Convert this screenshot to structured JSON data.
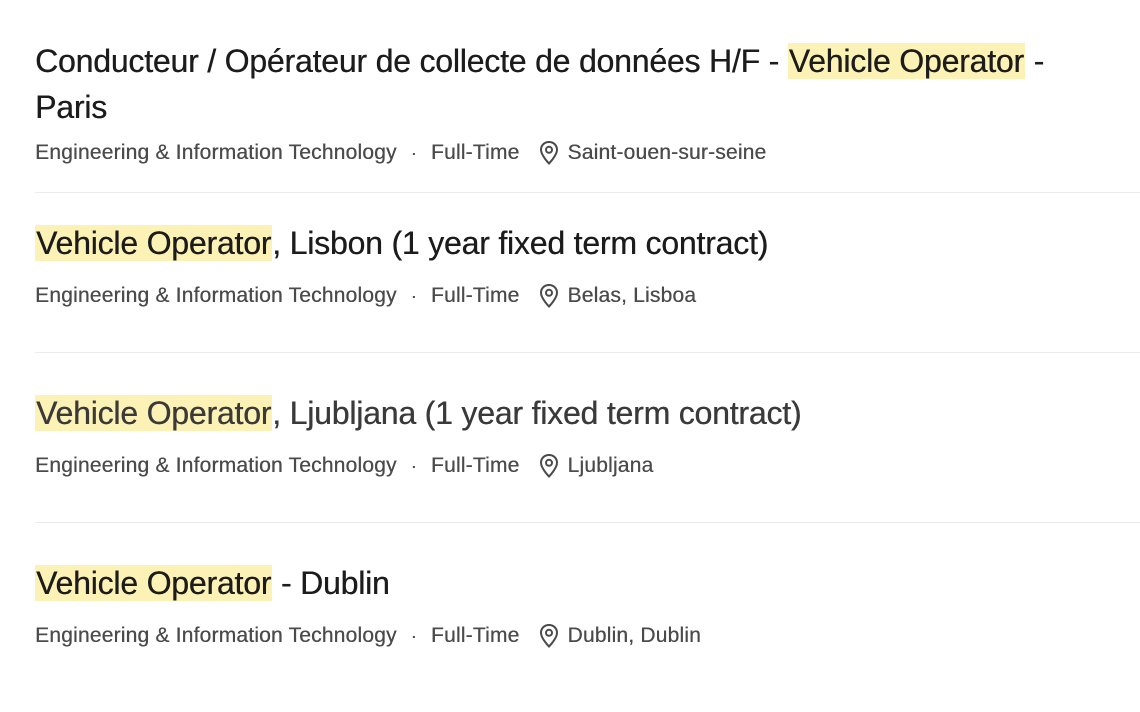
{
  "jobs": [
    {
      "title_pre": "Conducteur / Opérateur de collecte de données H/F - ",
      "title_hl": "Vehicle Operator",
      "title_post": " - Paris",
      "department": "Engineering & Information Technology",
      "separator": "·",
      "type": "Full-Time",
      "location": "Saint-ouen-sur-seine"
    },
    {
      "title_pre": "",
      "title_hl": "Vehicle Operator",
      "title_post": ", Lisbon (1 year fixed term contract)",
      "department": "Engineering & Information Technology",
      "separator": "·",
      "type": "Full-Time",
      "location": "Belas, Lisboa"
    },
    {
      "title_pre": "",
      "title_hl": "Vehicle Operator",
      "title_post": ", Ljubljana (1 year fixed term contract)",
      "department": "Engineering & Information Technology",
      "separator": "·",
      "type": "Full-Time",
      "location": "Ljubljana"
    },
    {
      "title_pre": "",
      "title_hl": "Vehicle Operator",
      "title_post": " - Dublin",
      "department": "Engineering & Information Technology",
      "separator": "·",
      "type": "Full-Time",
      "location": "Dublin, Dublin"
    }
  ],
  "colors": {
    "highlight": "#fdf2b6",
    "text": "#1c1c1c",
    "meta": "#4b4b4b",
    "divider": "#ececec"
  },
  "icons": {
    "location": "location-pin-icon"
  }
}
